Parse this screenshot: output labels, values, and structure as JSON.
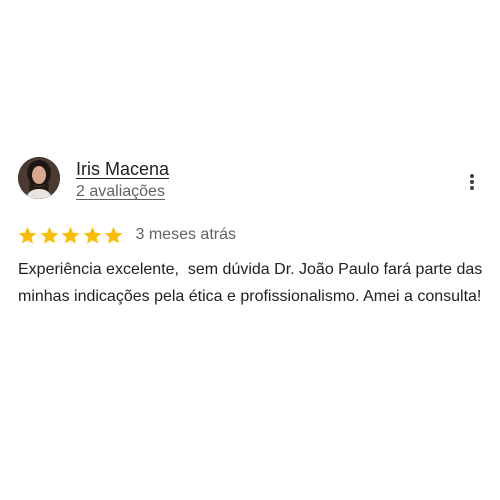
{
  "review": {
    "reviewer": {
      "name": "Iris Macena",
      "review_count": "2 avaliações",
      "avatar_icon": "user-photo"
    },
    "rating": {
      "stars": 5,
      "max_stars": 5,
      "star_color": "#fbbc04"
    },
    "date": "3 meses atrás",
    "text": "Experiência excelente,  sem dúvida Dr. João Paulo fará parte das minhas indicações pela ética e profissionalismo. Amei a consulta!",
    "menu_icon": "more-vert-icon"
  }
}
